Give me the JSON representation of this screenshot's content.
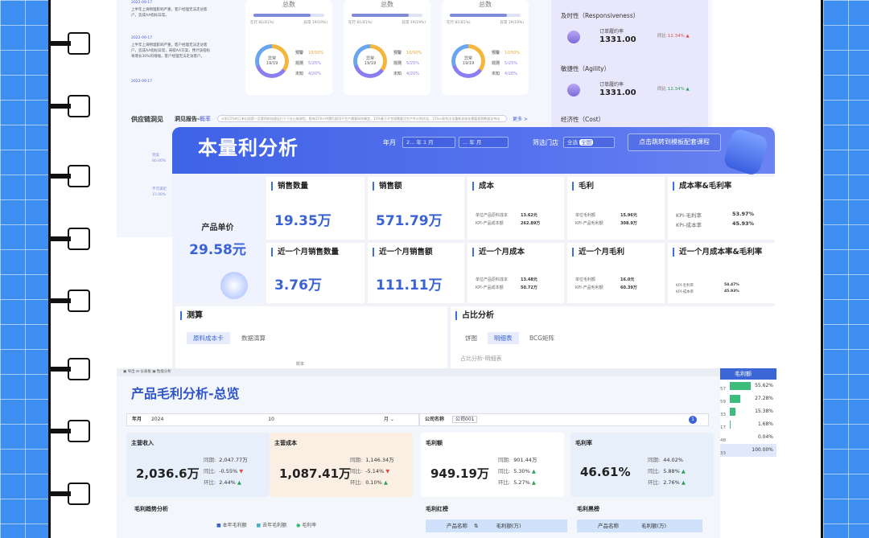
{
  "panel_a": {
    "timeline": [
      {
        "date": "2022-09-17",
        "text": "上半年上海物理影响严重，客户经理无法走访客户，造成AA指标异常。"
      },
      {
        "date": "2022-09-17",
        "text": "上半年上海物理影响严重，客户经理无法走访客户，造成AA指标异常，采取AA方案，预计该指标将增长30%的增幅，客户经理无法走访客户。"
      },
      {
        "date": "2022-09-17",
        "text": ""
      }
    ],
    "cards": [
      {
        "title": "总数",
        "left": "在行 81(81%)",
        "right": "异常 19(19%)",
        "center": "异常",
        "ratio": "19/19",
        "legend": [
          {
            "k": "预警",
            "v": "10/50%"
          },
          {
            "k": "观测",
            "v": "5/25%"
          },
          {
            "k": "未知",
            "v": "4/20%"
          }
        ]
      },
      {
        "title": "总数",
        "left": "在行 81(81%)",
        "right": "异常 19(19%)",
        "center": "异常",
        "ratio": "19/19",
        "legend": [
          {
            "k": "预警",
            "v": "10/50%"
          },
          {
            "k": "观测",
            "v": "5/25%"
          },
          {
            "k": "未知",
            "v": "4/20%"
          }
        ]
      },
      {
        "title": "总数",
        "left": "在行 81(81%)",
        "right": "异常 19(19%)",
        "center": "异常",
        "ratio": "19/19",
        "legend": [
          {
            "k": "预警",
            "v": "10/50%"
          },
          {
            "k": "观测",
            "v": "5/25%"
          },
          {
            "k": "未知",
            "v": "4/20%"
          }
        ]
      }
    ],
    "supply_title": "供应链洞见",
    "insight_label": "洞见报告-",
    "insight_link": "概率",
    "insight_text": "计划15%的订单出现第一至第四的加速运行于下在让能源型，影响15%+供需匹配用于生产需要研究确定，15%基于不专理需要注生产件计划优化，15%+联系注法重新初始化需要规划数据支持出",
    "more": "更多 >",
    "left_labels": [
      "完美",
      "80.00%",
      "不可满足",
      "15.00%"
    ],
    "right": {
      "s1": "及时性（Responsiveness）",
      "s2": "敏捷性（Agility）",
      "s3": "经济性（Cost）",
      "k1": {
        "name": "订单履约率",
        "value": "1331.00",
        "cmp": "同比",
        "pct": "12.34%"
      },
      "k2": {
        "name": "订单履约率",
        "value": "1331.00",
        "cmp": "同比",
        "pct": "12.34%"
      }
    }
  },
  "panel_b": {
    "title": "本量利分析",
    "year_label": "年月",
    "year_val": "2...  年 1  月",
    "year_val2": "... 年  月",
    "store_label": "筛选门店",
    "store_val": "全选",
    "store_tag": "全国",
    "jump": "点击跳转到模板配套课程",
    "unit_name": "产品单价",
    "unit_value": "29.58元",
    "cards": [
      {
        "label": "销售数量",
        "value": "19.35万"
      },
      {
        "label": "销售额",
        "value": "571.79万"
      },
      {
        "label": "成本",
        "r1k": "单位产品原料成本",
        "r1v": "13.62元",
        "r2k": "KPI-产品成本额",
        "r2v": "262.89万"
      },
      {
        "label": "毛利",
        "r1k": "单位毛利额",
        "r1v": "15.96元",
        "r2k": "KPI-产品毛利额",
        "r2v": "308.9万"
      },
      {
        "label": "成本率&毛利率",
        "r1k": "KPI-毛利率",
        "r1v": "53.97%",
        "r2k": "KPI-成本率",
        "r2v": "45.93%"
      },
      {
        "label": "近一个月销售数量",
        "value": "3.76万"
      },
      {
        "label": "近一个月销售额",
        "value": "111.11万"
      },
      {
        "label": "近一个月成本",
        "r1k": "单位产品原料成本",
        "r1v": "13.48元",
        "r2k": "KPI-产品成本额",
        "r2v": "50.72万"
      },
      {
        "label": "近一个月毛利",
        "r1k": "单位毛利额",
        "r1v": "16.0元",
        "r2k": "KPI-产品毛利额",
        "r2v": "60.39万"
      },
      {
        "label": "近一个月成本率&毛利率",
        "r1k": "KPI-毛利率",
        "r1v": "54.47%",
        "r2k": "KPI-成本率",
        "r2v": "45.93%"
      }
    ],
    "calc": "测算",
    "calc_tabs": [
      "原料成本卡",
      "数据演算"
    ],
    "calc_note": "概率",
    "ratio": "占比分析",
    "ratio_tabs": [
      "饼图",
      "明细表",
      "BCG矩阵"
    ],
    "ratio_sub": "占比分析-明细表"
  },
  "panel_c": {
    "toolbar": "▣ 导出  ⊟ 仪表板  ▣ 性能分析",
    "title": "产品毛利分析-总览",
    "year_label": "年月",
    "year_val": "2024",
    "month_val": "10",
    "month_unit": "月",
    "company_label": "公司名称",
    "company_val": "公司001",
    "badge": "1",
    "kpis": [
      {
        "title": "主营收入",
        "value": "2,036.6万",
        "r1": "2,047.77万",
        "r2": "-0.55%",
        "r3": "2.44%"
      },
      {
        "title": "主营成本",
        "value": "1,087.41万",
        "r1": "1,146.34万",
        "r2": "-5.14%",
        "r3": "0.10%"
      },
      {
        "title": "毛利额",
        "value": "949.19万",
        "r1": "901.44万",
        "r2": "5.30%",
        "r3": "5.27%"
      },
      {
        "title": "毛利率",
        "value": "46.61%",
        "r1": "44.02%",
        "r2": "5.88%",
        "r3": "2.76%"
      }
    ],
    "labels": {
      "tb": "同期:",
      "yoy": "同比:",
      "mom": "环比:"
    },
    "trend": "毛利趋势分析",
    "legend": [
      "本年毛利额",
      "去年毛利额",
      "毛利率"
    ],
    "red": "毛利红榜",
    "black": "毛利黑榜",
    "col1": "产品名称",
    "col2": "毛利额(万)",
    "side_head": "毛利额",
    "side_rows": [
      {
        "k": "57",
        "v": "55.62%"
      },
      {
        "k": "59",
        "v": "27.28%"
      },
      {
        "k": "33",
        "v": "15.38%"
      },
      {
        "k": "17",
        "v": "1.68%"
      },
      {
        "k": "48",
        "v": "0.04%"
      },
      {
        "k": "33",
        "v": "100.00%"
      }
    ]
  },
  "colors": {
    "accent": "#3b62d4",
    "up": "#2aa05a",
    "down": "#e24b4b"
  }
}
